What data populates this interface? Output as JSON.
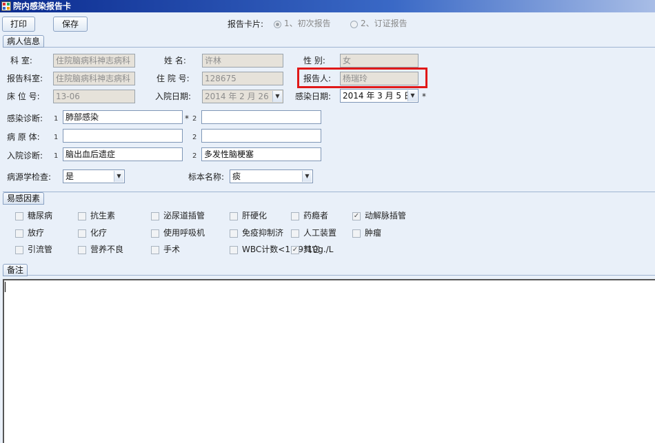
{
  "window": {
    "title": "院内感染报告卡"
  },
  "toolbar": {
    "print_label": "打印",
    "save_label": "保存",
    "report_type_label": "报告卡片:",
    "report_options": [
      {
        "label": "1、初次报告",
        "selected": true
      },
      {
        "label": "2、订证报告",
        "selected": false
      }
    ]
  },
  "patient_info": {
    "group_title": "病人信息",
    "dept_label": "科    室:",
    "dept_value": "住院脑病科神志病科",
    "name_label": "姓  名:",
    "name_value": "许林",
    "gender_label": "性  别:",
    "gender_value": "女",
    "report_dept_label": "报告科室:",
    "report_dept_value": "住院脑病科神志病科",
    "admission_no_label": "住 院 号:",
    "admission_no_value": "128675",
    "reporter_label": "报告人:",
    "reporter_value": "杨瑞玲",
    "bed_label": "床 位 号:",
    "bed_value": "13-06",
    "admit_date_label": "入院日期:",
    "admit_date_value": "2014 年 2 月 26 日",
    "infect_date_label": "感染日期:",
    "infect_date_value": "2014 年 3 月 5 日",
    "infect_diag_label": "感染诊断:",
    "infect_diag_1": "肺部感染",
    "infect_diag_2": "",
    "pathogen_label": "病 原 体:",
    "pathogen_1": "",
    "pathogen_2": "",
    "admit_diag_label": "入院诊断:",
    "admit_diag_1": "脑出血后遗症",
    "admit_diag_2": "多发性脑梗塞",
    "etiology_label": "病源学检查:",
    "etiology_value": "是",
    "specimen_label": "标本名称:",
    "specimen_value": "痰",
    "num_1": "1",
    "num_2": "2",
    "required_star": "*"
  },
  "risk_factors": {
    "group_title": "易感因素",
    "items": [
      {
        "label": "糖尿病",
        "checked": false
      },
      {
        "label": "抗生素",
        "checked": false
      },
      {
        "label": "泌尿道插管",
        "checked": false
      },
      {
        "label": "肝硬化",
        "checked": false
      },
      {
        "label": "药瘾者",
        "checked": false
      },
      {
        "label": "动解脉插管",
        "checked": true
      },
      {
        "label": "放疗",
        "checked": false
      },
      {
        "label": "化疗",
        "checked": false
      },
      {
        "label": "使用呼吸机",
        "checked": false
      },
      {
        "label": "免疫抑制济",
        "checked": false
      },
      {
        "label": "人工装置",
        "checked": false
      },
      {
        "label": "肿瘤",
        "checked": false
      },
      {
        "label": "引流管",
        "checked": false
      },
      {
        "label": "营养不良",
        "checked": false
      },
      {
        "label": "手术",
        "checked": false
      },
      {
        "label": "WBC计数<1.59*10g./L",
        "checked": false
      },
      {
        "label": "其它",
        "checked": true
      }
    ]
  },
  "notes": {
    "group_title": "备注",
    "value": ""
  }
}
